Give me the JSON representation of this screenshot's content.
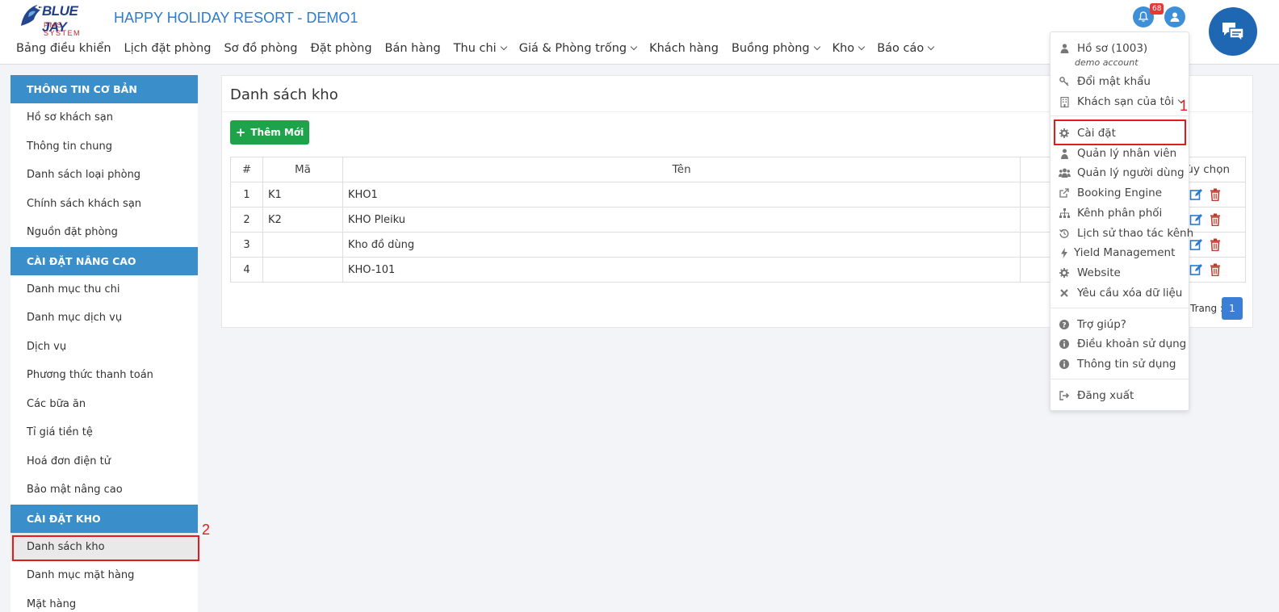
{
  "header": {
    "brand": "BLUE JAY",
    "brand_sub": "PMS SYSTEM",
    "title": "HAPPY HOLIDAY RESORT - DEMO1",
    "notification_count": "68"
  },
  "nav": [
    {
      "label": "Bảng điều khiển"
    },
    {
      "label": "Lịch đặt phòng"
    },
    {
      "label": "Sơ đồ phòng"
    },
    {
      "label": "Đặt phòng"
    },
    {
      "label": "Bán hàng"
    },
    {
      "label": "Thu chi"
    },
    {
      "label": "Giá & Phòng trống"
    },
    {
      "label": "Khách hàng"
    },
    {
      "label": "Buồng phòng"
    },
    {
      "label": "Kho"
    },
    {
      "label": "Báo cáo"
    }
  ],
  "sidebar": {
    "sections": [
      {
        "title": "THÔNG TIN CƠ BẢN",
        "items": [
          "Hồ sơ khách sạn",
          "Thông tin chung",
          "Danh sách loại phòng",
          "Chính sách khách sạn",
          "Nguồn đặt phòng"
        ]
      },
      {
        "title": "CÀI ĐẶT NÂNG CAO",
        "items": [
          "Danh mục thu chi",
          "Danh mục dịch vụ",
          "Dịch vụ",
          "Phương thức thanh toán",
          "Các bữa ăn",
          "Tỉ giá tiền tệ",
          "Hoá đơn điện tử",
          "Bảo mật nâng cao"
        ]
      },
      {
        "title": "CÀI ĐẶT KHO",
        "items": [
          "Danh sách kho",
          "Danh mục mặt hàng",
          "Mặt hàng"
        ]
      }
    ]
  },
  "main": {
    "title": "Danh sách kho",
    "add_label": "Thêm Mới",
    "columns": [
      "#",
      "Mã",
      "Tên",
      "",
      "Tùy chọn"
    ],
    "rows": [
      {
        "idx": "1",
        "code": "K1",
        "name": "KHO1"
      },
      {
        "idx": "2",
        "code": "K2",
        "name": "KHO Pleiku"
      },
      {
        "idx": "3",
        "code": "",
        "name": "Kho đồ dùng"
      },
      {
        "idx": "4",
        "code": "",
        "name": "KHO-101"
      }
    ],
    "pager_label": "Trang :",
    "page": "1"
  },
  "dropdown": {
    "profile": "Hồ sơ  (1003)",
    "account": "demo account",
    "change_password": "Đổi mật khẩu",
    "my_hotels": "Khách sạn của tôi",
    "settings": "Cài đặt",
    "staff": "Quản lý nhân viên",
    "users": "Quản lý người dùng",
    "booking_engine": "Booking Engine",
    "channels": "Kênh phân phối",
    "channel_history": "Lịch sử thao tác kênh",
    "yield": "Yield Management",
    "website": "Website",
    "delete_data": "Yêu cầu xóa dữ liệu",
    "help": "Trợ giúp?",
    "terms": "Điều khoản sử dụng",
    "usage": "Thông tin sử dụng",
    "logout": "Đăng xuất"
  },
  "annotations": {
    "one": "1",
    "two": "2"
  },
  "colors": {
    "accent": "#3a8fcb",
    "brand_blue": "#2b7bd2",
    "add_green": "#1fa34a",
    "highlight_red": "#e31b1b"
  }
}
